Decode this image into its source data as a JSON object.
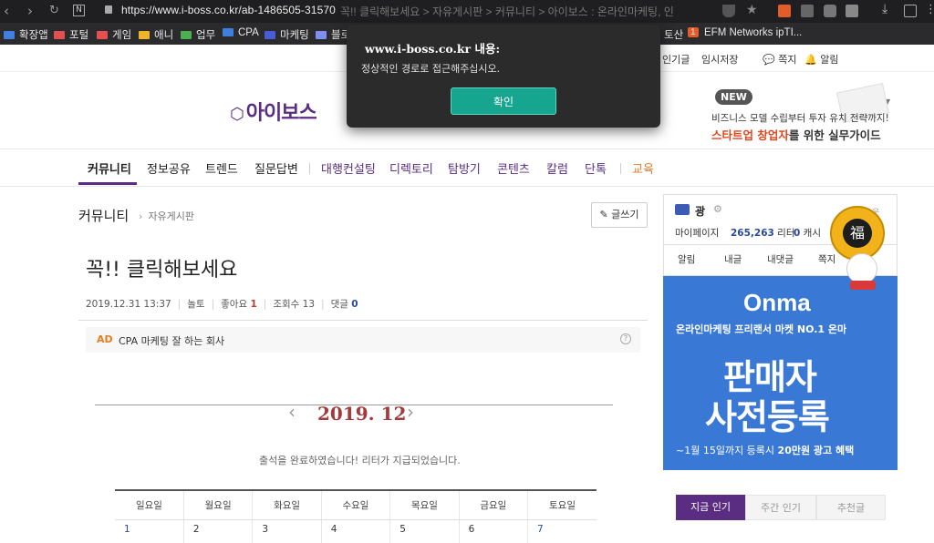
{
  "browser": {
    "url_main": "https://www.i-boss.co.kr/ab-1486505-31570",
    "url_title_faded": "꼭!! 클릭해보세요 > 자유게시판 > 커뮤니티 > 아이보스 : 온라인마케팅, 인",
    "bookmarks": [
      {
        "label": "확장앱",
        "color": "#3f7fe0"
      },
      {
        "label": "포털",
        "color": "#e45050"
      },
      {
        "label": "게임",
        "color": "#e45050"
      },
      {
        "label": "애니",
        "color": "#f0b429"
      },
      {
        "label": "업무",
        "color": "#4caf50"
      },
      {
        "label": "CPA",
        "color": "#3f7fe0"
      },
      {
        "label": "마케팅",
        "color": "#4a5bd6"
      },
      {
        "label": "블로",
        "color": "#7f8ff0"
      }
    ],
    "bookmark_right_1": "토산",
    "bookmark_right_2_badge": "1",
    "bookmark_right_2": "EFM Networks ipTI..."
  },
  "util": {
    "item1": "인기글",
    "item2": "임시저장",
    "item3": "쪽지",
    "item4": "알림"
  },
  "header": {
    "logo": "아이보스",
    "ad_new": "NEW",
    "ad_line1": "비즈니스 모델 수립부터 투자 유치 전략까지!",
    "ad_line2a": "스타트업 창업자",
    "ad_line2b": "를 위한 실무가이드"
  },
  "nav": {
    "items": [
      "커뮤니티",
      "정보공유",
      "트렌드",
      "질문답변",
      "대행컨설팅",
      "디렉토리",
      "탐방기",
      "콘텐츠",
      "칼럼",
      "단톡",
      "교육"
    ]
  },
  "main": {
    "crumb_section": "커뮤니티",
    "crumb_board": "자유게시판",
    "write_btn": "글쓰기",
    "post_title": "꼭!! 클릭해보세요",
    "date": "2019.12.31 13:37",
    "category": "놀토",
    "likes_label": "좋아요",
    "likes": "1",
    "views_label": "조회수",
    "views": "13",
    "comments_label": "댓글",
    "comments": "0",
    "ad_tag": "AD",
    "ad_text": "CPA 마케팅 잘 하는 회사",
    "ad_q": "?"
  },
  "calendar": {
    "month": "2019. 12",
    "message": "출석을 완료하였습니다! 리터가 지급되었습니다.",
    "weekdays": [
      "일요일",
      "월요일",
      "화요일",
      "수요일",
      "목요일",
      "금요일",
      "토요일"
    ],
    "days": [
      "1",
      "2",
      "3",
      "4",
      "5",
      "6",
      "7"
    ]
  },
  "sidebar": {
    "user_name": "광",
    "mypage": "마이페이지",
    "liter_value": "265,263",
    "liter_unit": "리터",
    "cash_value": "0",
    "cash_unit": "캐시",
    "tabs": [
      "알림",
      "내글",
      "내댓글",
      "쪽지"
    ],
    "logout_partial": "웃",
    "banner_brand": "Onma",
    "banner_sub": "온라인마케팅 프리랜서 마켓 NO.1 온마",
    "banner_big1": "판매자",
    "banner_big2": "사전등록",
    "banner_foot_a": "~1월 15일까지 등록시 ",
    "banner_foot_b": "20만원 광고 혜택",
    "mascot_char": "福",
    "rank_tabs": [
      "지금 인기",
      "주간 인기",
      "추천글"
    ]
  },
  "dialog": {
    "title": "www.i-boss.co.kr 내용:",
    "message": "정상적인 경로로 접근해주십시오.",
    "ok": "확인"
  },
  "colors": {
    "brand_purple": "#5a2d82",
    "dialog_bg": "#2b2b2b",
    "ok_green": "#16a58f",
    "banner_blue": "#3a78d6"
  }
}
